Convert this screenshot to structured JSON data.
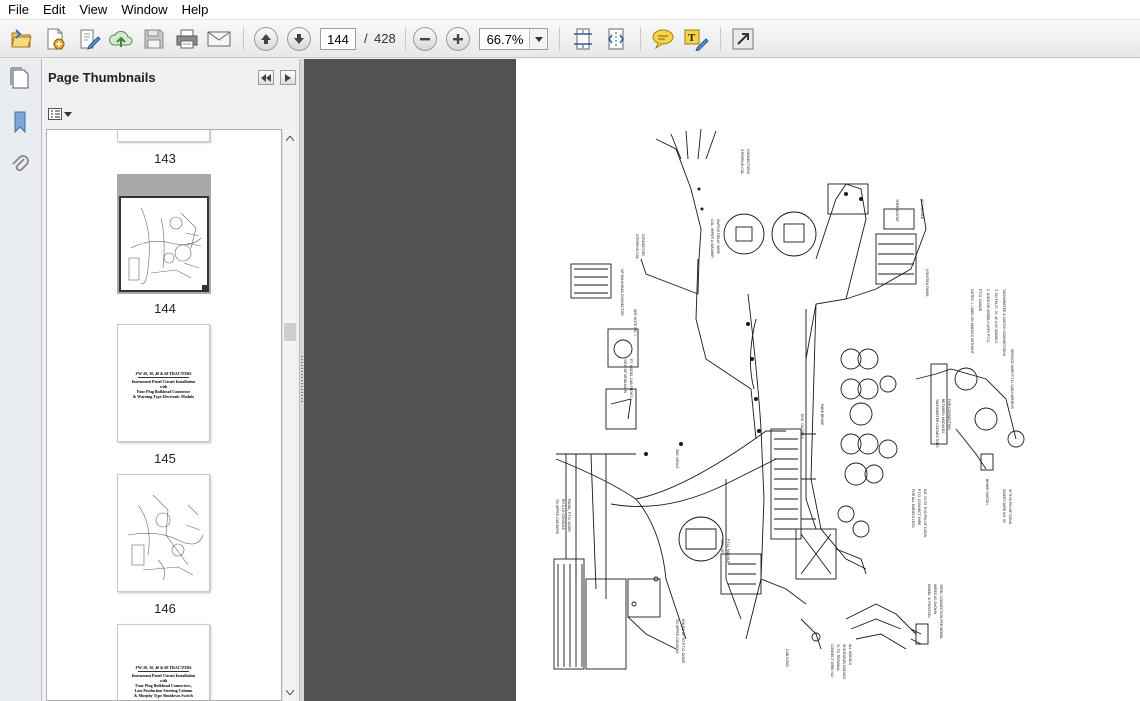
{
  "menu": [
    "File",
    "Edit",
    "View",
    "Window",
    "Help"
  ],
  "toolbar": {
    "current_page": "144",
    "page_separator": "/",
    "total_pages": "428",
    "zoom": "66.7%"
  },
  "panel": {
    "title": "Page Thumbnails"
  },
  "thumbnails": [
    {
      "label": "143"
    },
    {
      "label": "144"
    },
    {
      "label": "145",
      "lines": [
        "FW-20, 30, 40 & 60 TRACTORS",
        "Instrument Panel Circuit Installation",
        "with",
        "Four Plug Bulkhead Connector",
        "& Warning Type Electronic Module"
      ]
    },
    {
      "label": "146"
    },
    {
      "label": "",
      "lines": [
        "FW-20, 30, 40 & 60 TRACTORS",
        "Instrument Panel Circuit Installation",
        "with",
        "Four Plug Bulkhead Connectors,",
        "Late Production Steering Column",
        "& Murphy Type Shutdown Switch"
      ]
    }
  ],
  "icons": {
    "toolbar": [
      "open-icon",
      "create-pdf-icon",
      "edit-icon",
      "upload-icon",
      "save-icon",
      "print-icon",
      "email-icon",
      "previous-page-icon",
      "next-page-icon",
      "zoom-out-icon",
      "zoom-in-icon",
      "fit-page-icon",
      "fit-width-icon",
      "comment-icon",
      "highlight-icon",
      "fullscreen-icon"
    ],
    "nav": [
      "page-thumbnails-icon",
      "bookmarks-icon",
      "attachments-icon"
    ]
  },
  "colors": {
    "doc_background": "#525252",
    "nav_strip": "#e9edf2",
    "toolbar": "#ececec"
  }
}
